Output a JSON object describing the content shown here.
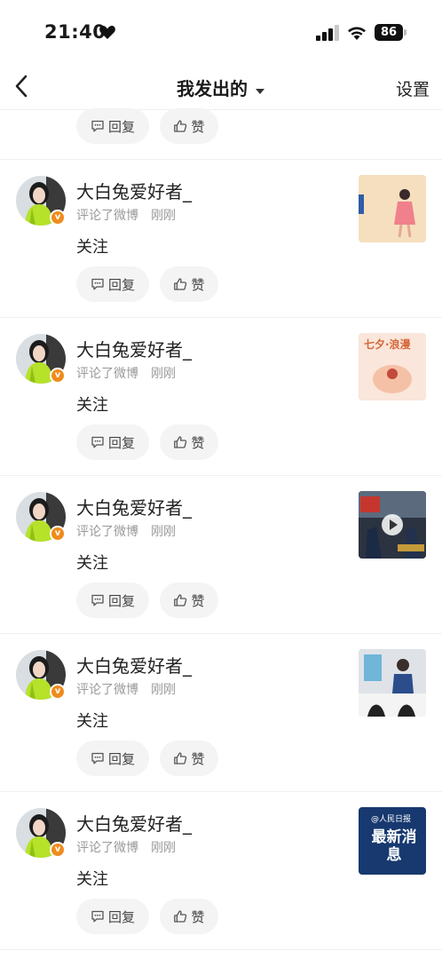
{
  "status_bar": {
    "time": "21:40",
    "battery": "86"
  },
  "nav": {
    "title": "我发出的",
    "settings": "设置"
  },
  "actions": {
    "reply": "回复",
    "like": "赞"
  },
  "items": [
    {
      "username": "大白兔爱好者_",
      "action": "评论了微博",
      "time": "刚刚",
      "comment": "关注",
      "thumb": "pink-illustration"
    },
    {
      "username": "大白兔爱好者_",
      "action": "评论了微博",
      "time": "刚刚",
      "comment": "关注",
      "thumb": "qixi-poster",
      "thumb_text": "七夕·浪漫"
    },
    {
      "username": "大白兔爱好者_",
      "action": "评论了微博",
      "time": "刚刚",
      "comment": "关注",
      "thumb": "video-meeting"
    },
    {
      "username": "大白兔爱好者_",
      "action": "评论了微博",
      "time": "刚刚",
      "comment": "关注",
      "thumb": "clinic-photo"
    },
    {
      "username": "大白兔爱好者_",
      "action": "评论了微博",
      "time": "刚刚",
      "comment": "关注",
      "thumb": "news-banner",
      "thumb_logo": "人民日报",
      "thumb_text": "最新消息"
    }
  ],
  "colors": {
    "accent": "#f08b1b",
    "pill_bg": "#f4f4f4",
    "meta": "#999999"
  }
}
